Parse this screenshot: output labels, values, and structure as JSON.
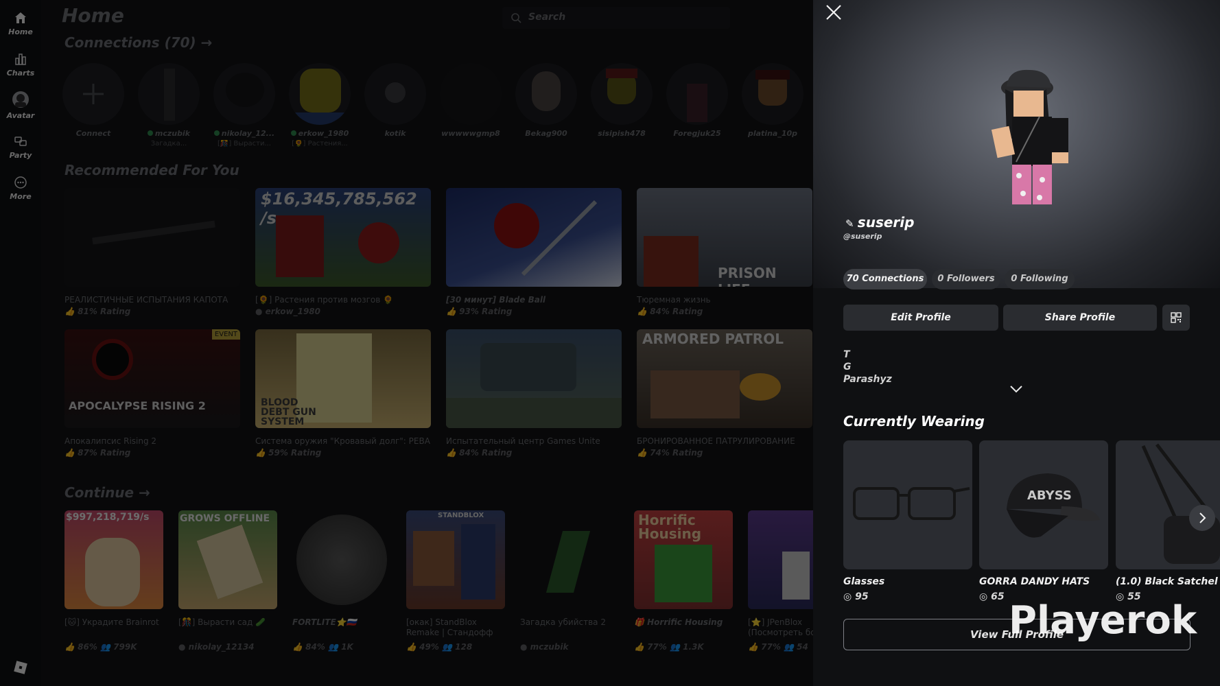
{
  "sidebar": {
    "items": [
      {
        "label": "Home",
        "icon": "home-icon"
      },
      {
        "label": "Charts",
        "icon": "charts-icon"
      },
      {
        "label": "Avatar",
        "icon": "avatar-icon"
      },
      {
        "label": "Party",
        "icon": "party-icon"
      },
      {
        "label": "More",
        "icon": "more-icon"
      }
    ],
    "logo": "roblox-logo-icon"
  },
  "main": {
    "title": "Home",
    "search_placeholder": "Search",
    "connections_title": "Connections (70)",
    "connections": [
      {
        "name": "Connect",
        "status": ""
      },
      {
        "name": "mczubik",
        "status": "Загадка..."
      },
      {
        "name": "nikolay_12...",
        "status": "[🎊] Вырасти..."
      },
      {
        "name": "erkow_1980",
        "status": "[🌻] Растения..."
      },
      {
        "name": "kotik",
        "status": ""
      },
      {
        "name": "wwwwwgmp8",
        "status": ""
      },
      {
        "name": "Bekag900",
        "status": ""
      },
      {
        "name": "sisipish478",
        "status": ""
      },
      {
        "name": "Foregjuk25",
        "status": ""
      },
      {
        "name": "platina_10p",
        "status": ""
      }
    ],
    "recommended_title": "Recommended For You",
    "recommended": [
      {
        "title": "РЕАЛИСТИЧНЫЕ ИСПЫТАНИЯ КАПОТА",
        "rating": "81% Rating",
        "overlay": ""
      },
      {
        "title": "[🌻] Растения против мозгов 🌻",
        "rating": "erkow_1980",
        "overlay": "$16,345,785,562 /s"
      },
      {
        "title": "[30 минут] Blade Ball",
        "rating": "93% Rating",
        "overlay": ""
      },
      {
        "title": "Тюремная жизнь",
        "rating": "84% Rating",
        "overlay": "PRISON LIFE"
      },
      {
        "title": "Апокалипсис Rising 2",
        "rating": "87% Rating",
        "overlay": "APOCALYPSE RISING 2",
        "badge": "EVENT"
      },
      {
        "title": "Система оружия \"Кровавый долг\": РЕВАМП",
        "rating": "59% Rating",
        "overlay": "BLOOD DEBT GUN SYSTEM"
      },
      {
        "title": "Испытательный центр Games Unite",
        "rating": "84% Rating",
        "overlay": ""
      },
      {
        "title": "БРОНИРОВАННОЕ ПАТРУЛИРОВАНИЕ",
        "rating": "74% Rating",
        "overlay": "ARMORED PATROL"
      }
    ],
    "continue_title": "Continue",
    "continue": [
      {
        "title": "[🐱] Украдите Brainrot",
        "rating": "86%",
        "players": "799K",
        "overlay": "$997,218,719/s"
      },
      {
        "title": "[🎊] Вырасти сад 🥒",
        "rating": "nikolay_12134",
        "players": "",
        "overlay": "GROWS OFFLINE"
      },
      {
        "title": "FORTLITE⭐🇷🇺",
        "rating": "84%",
        "players": "1K",
        "overlay": ""
      },
      {
        "title": "[окак] StandBlox Remake | Стандофф",
        "rating": "49%",
        "players": "128",
        "overlay": "STANDBLOX"
      },
      {
        "title": "Загадка убийства 2",
        "rating": "mczubik",
        "players": "",
        "overlay": ""
      },
      {
        "title": "🎁 Horrific Housing",
        "rating": "77%",
        "players": "1.3K",
        "overlay": "Horrific Housing"
      },
      {
        "title": "[⭐] JPenBlox (Посмотреть бо...",
        "rating": "77%",
        "players": "54",
        "overlay": ""
      }
    ]
  },
  "profile": {
    "display_name": "suserip",
    "username": "@suserip",
    "stats": {
      "connections": "70 Connections",
      "followers": "0 Followers",
      "following": "0 Following"
    },
    "edit_label": "Edit Profile",
    "share_label": "Share Profile",
    "bio_lines": [
      "T",
      "G",
      "Parashyz"
    ],
    "wearing_title": "Currently Wearing",
    "items": [
      {
        "name": "Glasses",
        "price": "95"
      },
      {
        "name": "GORRA   DANDY HATS",
        "price": "65"
      },
      {
        "name": "(1.0) Black Satchel",
        "price": "55"
      }
    ],
    "view_full_label": "View Full Profile"
  },
  "watermark": "Playerok",
  "colors": {
    "panel_bg": "#0f1012",
    "button_bg": "#2a2c30",
    "online_dot": "#2f8a4f"
  }
}
